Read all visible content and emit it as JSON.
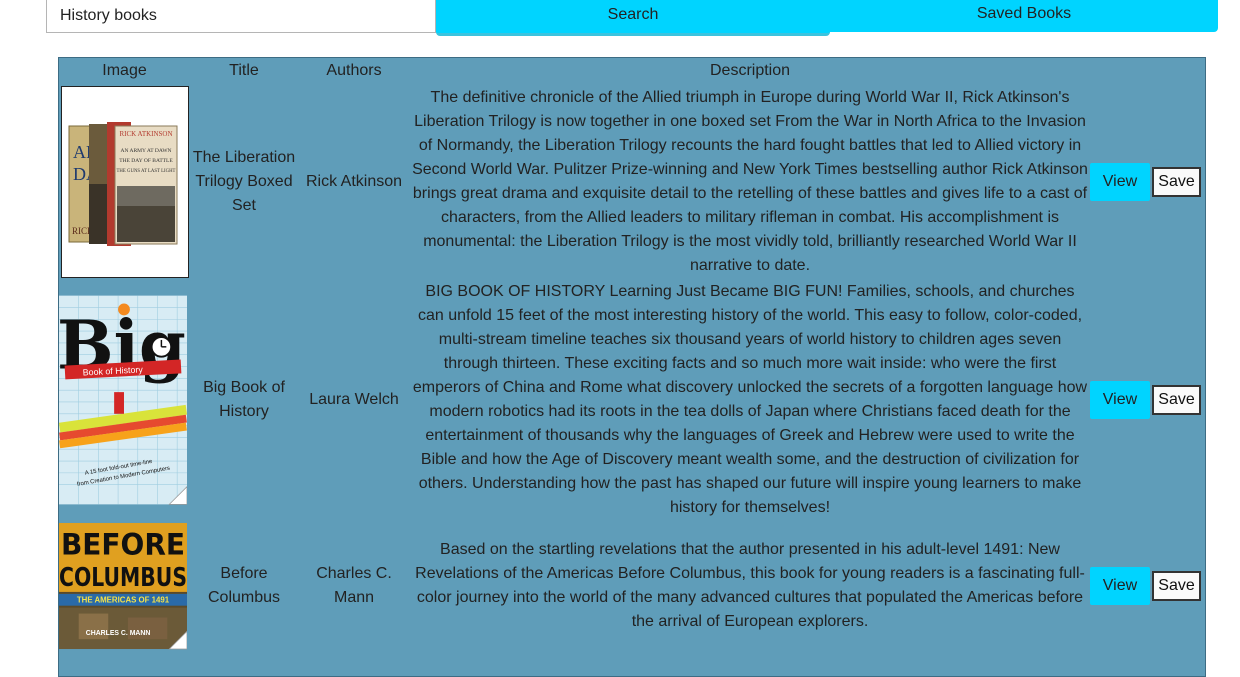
{
  "search": {
    "value": "History books",
    "button_label": "Search",
    "saved_label": "Saved Books"
  },
  "table": {
    "headers": [
      "Image",
      "Title",
      "Authors",
      "Description"
    ],
    "rows": [
      {
        "title": "The Liberation Trilogy Boxed Set",
        "authors": "Rick Atkinson",
        "description": "The definitive chronicle of the Allied triumph in Europe during World War II, Rick Atkinson's Liberation Trilogy is now together in one boxed set From the War in North Africa to the Invasion of Normandy, the Liberation Trilogy recounts the hard fought battles that led to Allied victory in Second World War. Pulitzer Prize-winning and New York Times bestselling author Rick Atkinson brings great drama and exquisite detail to the retelling of these battles and gives life to a cast of characters, from the Allied leaders to military rifleman in combat. His accomplishment is monumental: the Liberation Trilogy is the most vividly told, brilliantly researched World War II narrative to date.",
        "view_label": "View",
        "save_label": "Save",
        "cover_text": [
          "AN ARMY AT DAWN",
          "THE DAY OF BATTLE",
          "THE GUNS AT LAST LIGHT",
          "RICK ATKINSON"
        ]
      },
      {
        "title": "Big Book of History",
        "authors": "Laura Welch",
        "description": "BIG BOOK OF HISTORY Learning Just Became BIG FUN! Families, schools, and churches can unfold 15 feet of the most interesting history of the world. This easy to follow, color-coded, multi-stream timeline teaches six thousand years of world history to children ages seven through thirteen. These exciting facts and so much more wait inside: who were the first emperors of China and Rome what discovery unlocked the secrets of a forgotten language how modern robotics had its roots in the tea dolls of Japan where Christians faced death for the entertainment of thousands why the languages of Greek and Hebrew were used to write the Bible and how the Age of Discovery meant wealth some, and the destruction of civilization for others. Understanding how the past has shaped our future will inspire young learners to make history for themselves!",
        "view_label": "View",
        "save_label": "Save",
        "cover_text": [
          "Big",
          "Book of History",
          "A 15 foot fold-out time-line",
          "from Creation to Modern Computers"
        ]
      },
      {
        "title": "Before Columbus",
        "authors": "Charles C. Mann",
        "description": "Based on the startling revelations that the author presented in his adult-level 1491: New Revelations of the Americas Before Columbus, this book for young readers is a fascinating full-color journey into the world of the many advanced cultures that populated the Americas before the arrival of European explorers.",
        "view_label": "View",
        "save_label": "Save",
        "cover_text": [
          "BEFORE",
          "COLUMBUS",
          "THE AMERICAS OF 1491",
          "CHARLES C. MANN"
        ]
      }
    ]
  },
  "colors": {
    "accent": "#00d4ff",
    "panel": "#5f9db9"
  }
}
